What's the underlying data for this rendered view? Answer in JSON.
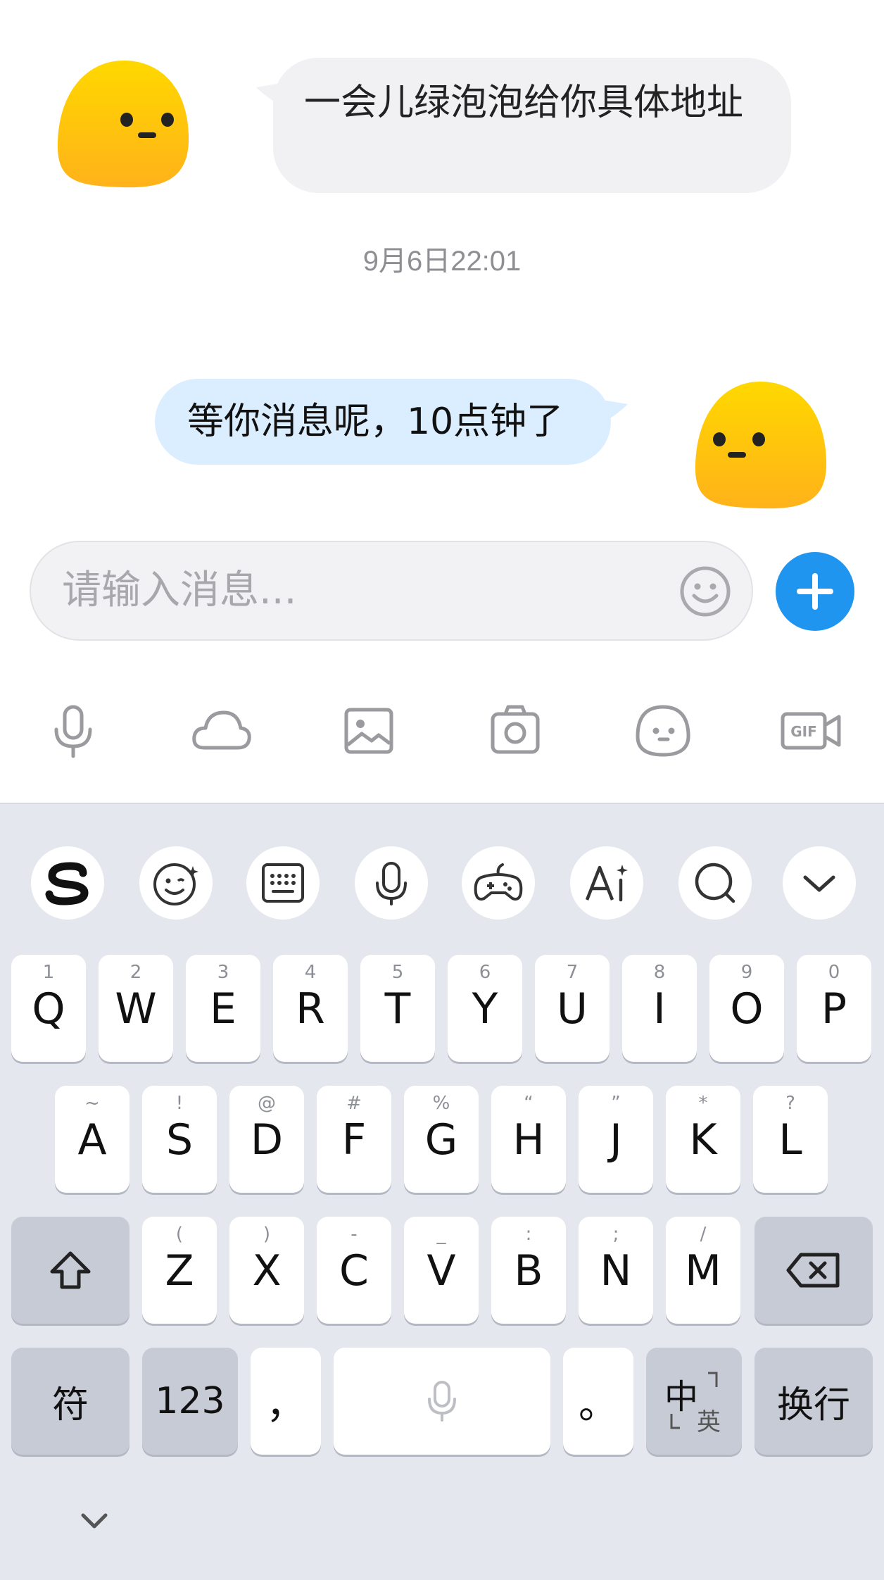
{
  "chat": {
    "incoming": {
      "text": "一会儿绿泡泡给你具体地址"
    },
    "timestamp": "9月6日22:01",
    "outgoing": {
      "text": "等你消息呢，10点钟了"
    }
  },
  "input": {
    "placeholder": "请输入消息...",
    "emoji_icon": "smiley-icon",
    "plus_icon": "plus-icon"
  },
  "tools": [
    "microphone-icon",
    "cloud-icon",
    "image-icon",
    "camera-icon",
    "sticker-icon",
    "gif-icon"
  ],
  "keyboard": {
    "toolbar": [
      "sogou-logo-icon",
      "emoji-icon",
      "keyboard-icon",
      "microphone-icon",
      "gamepad-icon",
      "ai-text-icon",
      "search-icon",
      "chevron-down-icon"
    ],
    "row1": [
      {
        "key": "Q",
        "hint": "1"
      },
      {
        "key": "W",
        "hint": "2"
      },
      {
        "key": "E",
        "hint": "3"
      },
      {
        "key": "R",
        "hint": "4"
      },
      {
        "key": "T",
        "hint": "5"
      },
      {
        "key": "Y",
        "hint": "6"
      },
      {
        "key": "U",
        "hint": "7"
      },
      {
        "key": "I",
        "hint": "8"
      },
      {
        "key": "O",
        "hint": "9"
      },
      {
        "key": "P",
        "hint": "0"
      }
    ],
    "row2": [
      {
        "key": "A",
        "hint": "~"
      },
      {
        "key": "S",
        "hint": "!"
      },
      {
        "key": "D",
        "hint": "@"
      },
      {
        "key": "F",
        "hint": "#"
      },
      {
        "key": "G",
        "hint": "%"
      },
      {
        "key": "H",
        "hint": "“"
      },
      {
        "key": "J",
        "hint": "”"
      },
      {
        "key": "K",
        "hint": "*"
      },
      {
        "key": "L",
        "hint": "?"
      }
    ],
    "row3": [
      {
        "key": "Z",
        "hint": "("
      },
      {
        "key": "X",
        "hint": ")"
      },
      {
        "key": "C",
        "hint": "-"
      },
      {
        "key": "V",
        "hint": "_"
      },
      {
        "key": "B",
        "hint": ":"
      },
      {
        "key": "N",
        "hint": ";"
      },
      {
        "key": "M",
        "hint": "/"
      }
    ],
    "symbols_label": "符",
    "numbers_label": "123",
    "comma_label": "，",
    "period_label": "。",
    "lang_main": "中",
    "lang_sub": "英",
    "enter_label": "换行"
  }
}
